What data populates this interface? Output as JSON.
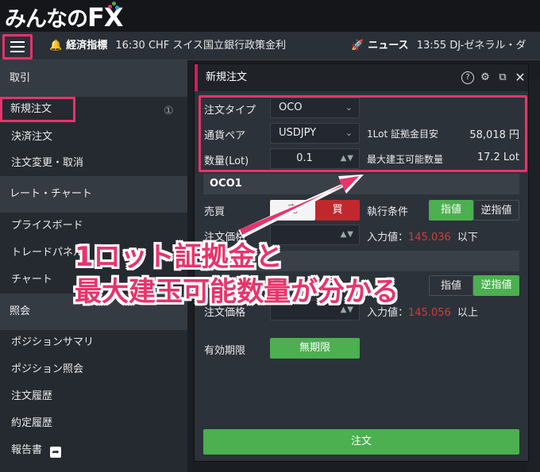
{
  "brand": {
    "name": "みんなの",
    "fx": "FX"
  },
  "ticker": {
    "econ_label": "経済指標",
    "econ_text": "16:30 CHF スイス国立銀行政策金利",
    "news_label": "ニュース",
    "news_text": "13:55 DJ-ゼネラル・ダ"
  },
  "sidebar": {
    "sec_trade": "取引",
    "new_order": "新規注文",
    "new_order_badge": "①",
    "settle": "決済注文",
    "modify": "注文変更・取消",
    "sec_rate": "レート・チャート",
    "price_board": "プライスボード",
    "trade_panel": "トレードパネル",
    "chart": "チャート",
    "sec_inquiry": "照会",
    "pos_summary": "ポジションサマリ",
    "pos_inquiry": "ポジション照会",
    "order_history": "注文履歴",
    "exec_history": "約定履歴",
    "report": "報告書"
  },
  "dialog": {
    "title": "新規注文",
    "order_type_label": "注文タイプ",
    "order_type_value": "OCO",
    "pair_label": "通貨ペア",
    "pair_value": "USDJPY",
    "lot_margin_label": "1Lot 証拠金目安",
    "lot_margin_value": "58,018 円",
    "qty_label": "数量(Lot)",
    "qty_value": "0.1",
    "max_qty_label": "最大建玉可能数量",
    "max_qty_value": "17.2 Lot",
    "oco1_head": "OCO1",
    "side_label": "売買",
    "sell": "売",
    "buy": "買",
    "cond_label": "執行条件",
    "limit": "指値",
    "stop": "逆指値",
    "price_label": "注文価格",
    "input_label1": "入力値：",
    "input_val1": "145.036",
    "input_suffix1": "以下",
    "price_label2": "注文価格",
    "input_label2": "入力値：",
    "input_val2": "145.056",
    "input_suffix2": "以上",
    "expiry_label": "有効期限",
    "expiry_value": "無期限",
    "order_button": "注文"
  },
  "annotation": {
    "line1": "1ロット証拠金と",
    "line2": "最大建玉可能数量が分かる"
  },
  "colors": {
    "accent": "#e8336b",
    "green": "#4caf50",
    "red": "#c0282d"
  }
}
